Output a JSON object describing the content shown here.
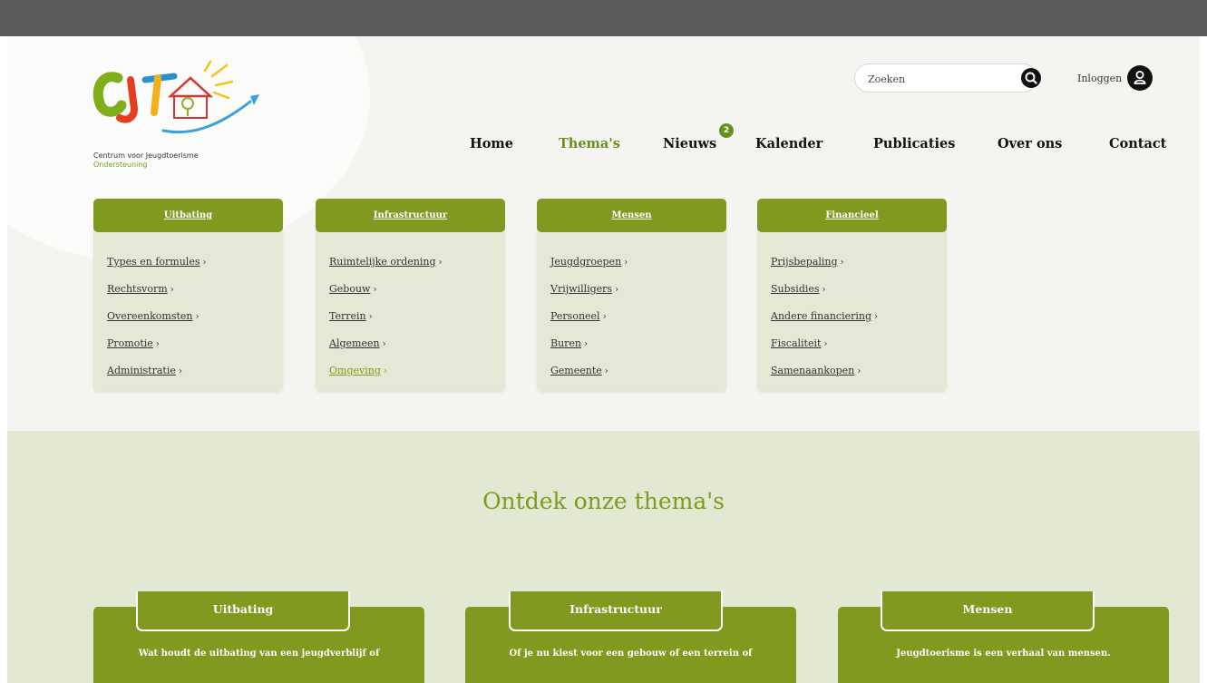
{
  "colors": {
    "brand_green": "#7f9a1e",
    "active_nav": "#6b8f1c",
    "panel_bg": "#e4e8d5",
    "section_bg": "#e3e8d2"
  },
  "logo": {
    "name": "Centrum voor Jeugdtoerisme",
    "sub": "Ondersteuning",
    "icon": "cjt-logo"
  },
  "header": {
    "search_placeholder": "Zoeken",
    "search_icon": "search-icon",
    "login_label": "Inloggen",
    "login_icon": "user-icon"
  },
  "nav": {
    "items": [
      "Home",
      "Thema's",
      "Nieuws",
      "Kalender",
      "Publicaties",
      "Over ons",
      "Contact"
    ],
    "active": "Thema's",
    "news_badge": "2"
  },
  "mega_menu": [
    {
      "title": "Uitbating",
      "links": [
        "Types en formules",
        "Rechtsvorm",
        "Overeenkomsten",
        "Promotie",
        "Administratie"
      ]
    },
    {
      "title": "Infrastructuur",
      "links": [
        "Ruimtelijke ordening",
        "Gebouw",
        "Terrein",
        "Algemeen",
        "Omgeving"
      ]
    },
    {
      "title": "Mensen",
      "links": [
        "Jeugdgroepen",
        "Vrijwilligers",
        "Personeel",
        "Buren",
        "Gemeente"
      ]
    },
    {
      "title": "Financieel",
      "links": [
        "Prijsbepaling",
        "Subsidies",
        "Andere financiering",
        "Fiscaliteit",
        "Samenaankopen"
      ]
    }
  ],
  "themes": {
    "title": "Ontdek onze thema's",
    "cards": [
      {
        "title": "Uitbating",
        "text": "Wat houdt de uitbating van een jeugdverblijf of"
      },
      {
        "title": "Infrastructuur",
        "text": "Of je nu kiest voor een gebouw of een terrein of"
      },
      {
        "title": "Mensen",
        "text": "Jeugdtoerisme is een verhaal van mensen."
      }
    ]
  }
}
